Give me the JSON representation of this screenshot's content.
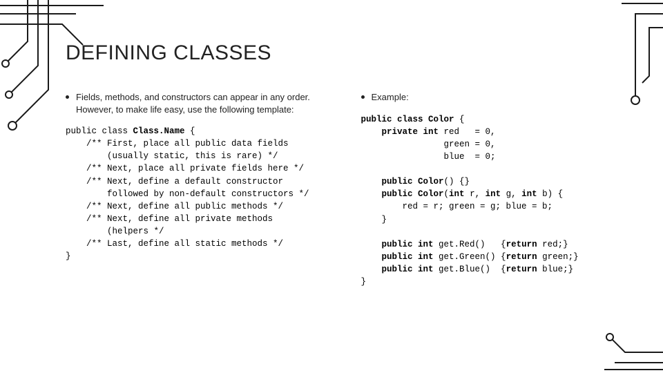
{
  "title": "DEFINING CLASSES",
  "left": {
    "bullet": "Fields, methods, and constructors can appear in any order. However, to make life easy, use the following template:",
    "code_open_pre": "public class ",
    "code_classname": "Class.Name",
    "code_open_post": " {",
    "code_lines": [
      "    /** First, place all public data fields",
      "        (usually static, this is rare) */",
      "    /** Next, place all private fields here */",
      "    /** Next, define a default constructor",
      "        followed by non-default constructors */",
      "    /** Next, define all public methods */",
      "    /** Next, define all private methods",
      "        (helpers */",
      "    /** Last, define all static methods */",
      "}"
    ]
  },
  "right": {
    "bullet": "Example:",
    "code_plain": "public class Color {\n    private int red   = 0,\n                green = 0,\n                blue  = 0;\n\n    public Color() {}\n    public Color(int r, int g, int b) {\n        red = r; green = g; blue = b;\n    }\n\n    public int get.Red()   {return red;}\n    public int get.Green() {return green;}\n    public int get.Blue()  {return blue;}\n}",
    "code_html": "<b>public class Color</b> {\n    <b>private int</b> red   = 0,\n                green = 0,\n                blue  = 0;\n\n    <b>public Color</b>() {}\n    <b>public Color</b>(<b>int</b> r, <b>int</b> g, <b>int</b> b) {\n        red = r; green = g; blue = b;\n    }\n\n    <b>public int</b> get.Red()   {<b>return</b> red;}\n    <b>public int</b> get.Green() {<b>return</b> green;}\n    <b>public int</b> get.Blue()  {<b>return</b> blue;}\n}"
  }
}
